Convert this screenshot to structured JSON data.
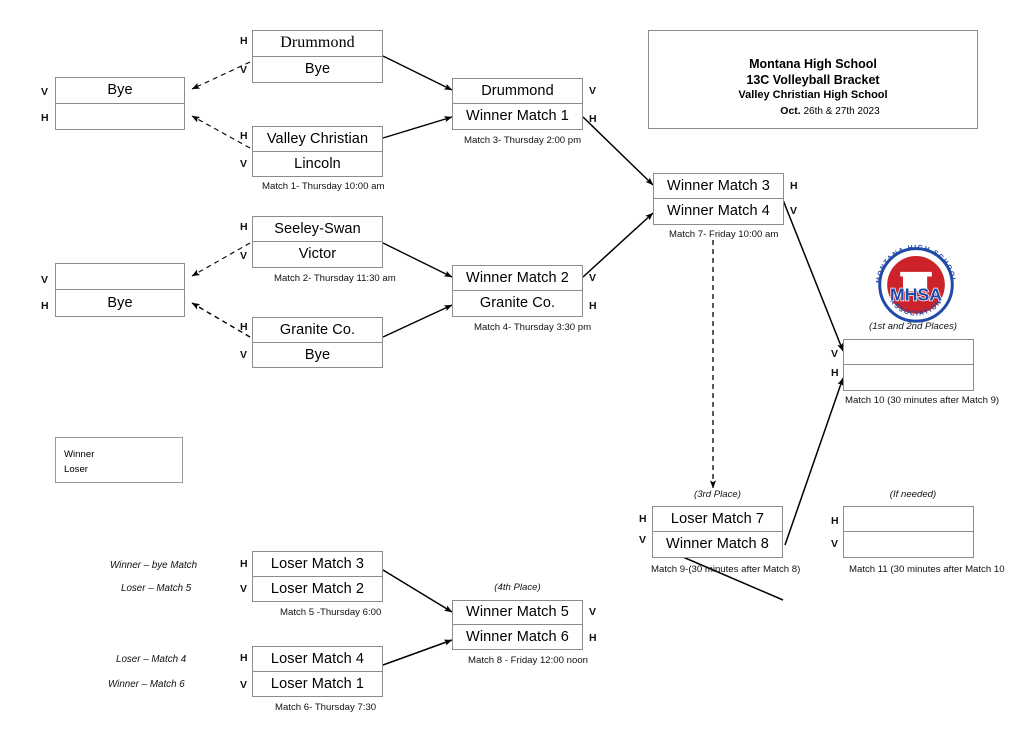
{
  "title": {
    "line1": "Montana High School",
    "line2": "13C Volleyball Bracket",
    "line3": "Valley Christian High School",
    "line4_bold": "Oct.",
    "line4_rest": "26th & 27th 2023"
  },
  "legend": {
    "winner_label": "Winner",
    "loser_label": "Loser"
  },
  "logo": {
    "alt": "mhsa-seal",
    "ring_text_top": "MONTANA HIGH SCHOOL",
    "ring_text_bottom": "ASSOCIATION",
    "center_text": "MHSA",
    "blue": "#1f4aa8",
    "red": "#cc2229"
  },
  "seed_letters": {
    "home": "H",
    "visitor": "V"
  },
  "matches": [
    {
      "id": "bye-top",
      "top": "Bye",
      "bottom": "",
      "caption": "",
      "seed_top": "V",
      "seed_bottom": "H"
    },
    {
      "id": "match1-upper",
      "top": "Drummond",
      "bottom": "Bye",
      "caption": "",
      "seed_top": "H",
      "seed_bottom": "V"
    },
    {
      "id": "match1",
      "top": "Valley Christian",
      "bottom": "Lincoln",
      "caption": "Match 1- Thursday 10:00 am",
      "seed_top": "H",
      "seed_bottom": "V"
    },
    {
      "id": "match3",
      "top": "Drummond",
      "bottom": "Winner Match 1",
      "caption": "Match 3- Thursday 2:00 pm",
      "seed_top": "V",
      "seed_bottom": "H"
    },
    {
      "id": "bye-lower",
      "top": "",
      "bottom": "Bye",
      "caption": "",
      "seed_top": "V",
      "seed_bottom": "H"
    },
    {
      "id": "match2",
      "top": "Seeley-Swan",
      "bottom": "Victor",
      "caption": "Match 2- Thursday 11:30 am",
      "seed_top": "H",
      "seed_bottom": "V"
    },
    {
      "id": "granite-bye",
      "top": "Granite Co.",
      "bottom": "Bye",
      "caption": "",
      "seed_top": "H",
      "seed_bottom": "V"
    },
    {
      "id": "match4",
      "top": "Winner Match 2",
      "bottom": "Granite Co.",
      "caption": "Match 4-  Thursday 3:30 pm",
      "seed_top": "V",
      "seed_bottom": "H"
    },
    {
      "id": "match7",
      "top": "Winner Match 3",
      "bottom": "Winner Match 4",
      "caption": "Match 7- Friday 10:00 am",
      "seed_top": "H",
      "seed_bottom": "V"
    },
    {
      "id": "match10",
      "top": "",
      "bottom": "",
      "caption": "Match 10 (30 minutes after Match 9)",
      "place": "(1st and 2nd Places)",
      "seed_top": "V",
      "seed_bottom": "H"
    },
    {
      "id": "match9",
      "top": "Loser Match 7",
      "bottom": "Winner Match 8",
      "caption": "Match 9-(30 minutes after Match 8)",
      "place": "(3rd Place)",
      "seed_top": "H",
      "seed_bottom": "V"
    },
    {
      "id": "match11",
      "top": "",
      "bottom": "",
      "caption": "Match 11 (30 minutes after Match 10",
      "place": "(If needed)",
      "seed_top": "H",
      "seed_bottom": "V"
    },
    {
      "id": "match5",
      "top": "Loser Match 3",
      "bottom": "Loser Match 2",
      "caption": "Match 5 -Thursday 6:00",
      "seed_top": "H",
      "seed_bottom": "V"
    },
    {
      "id": "match6",
      "top": "Loser Match 4",
      "bottom": "Loser Match 1",
      "caption": "Match 6- Thursday 7:30",
      "seed_top": "H",
      "seed_bottom": "V"
    },
    {
      "id": "match8",
      "top": "Winner Match 5",
      "bottom": "Winner Match 6",
      "caption": "Match 8 - Friday 12:00 noon",
      "place": "(4th Place)",
      "seed_top": "V",
      "seed_bottom": "H"
    }
  ],
  "feeder_notes": [
    "Winner – bye Match",
    "Loser – Match 5",
    "Loser – Match 4",
    "Winner – Match 6"
  ]
}
